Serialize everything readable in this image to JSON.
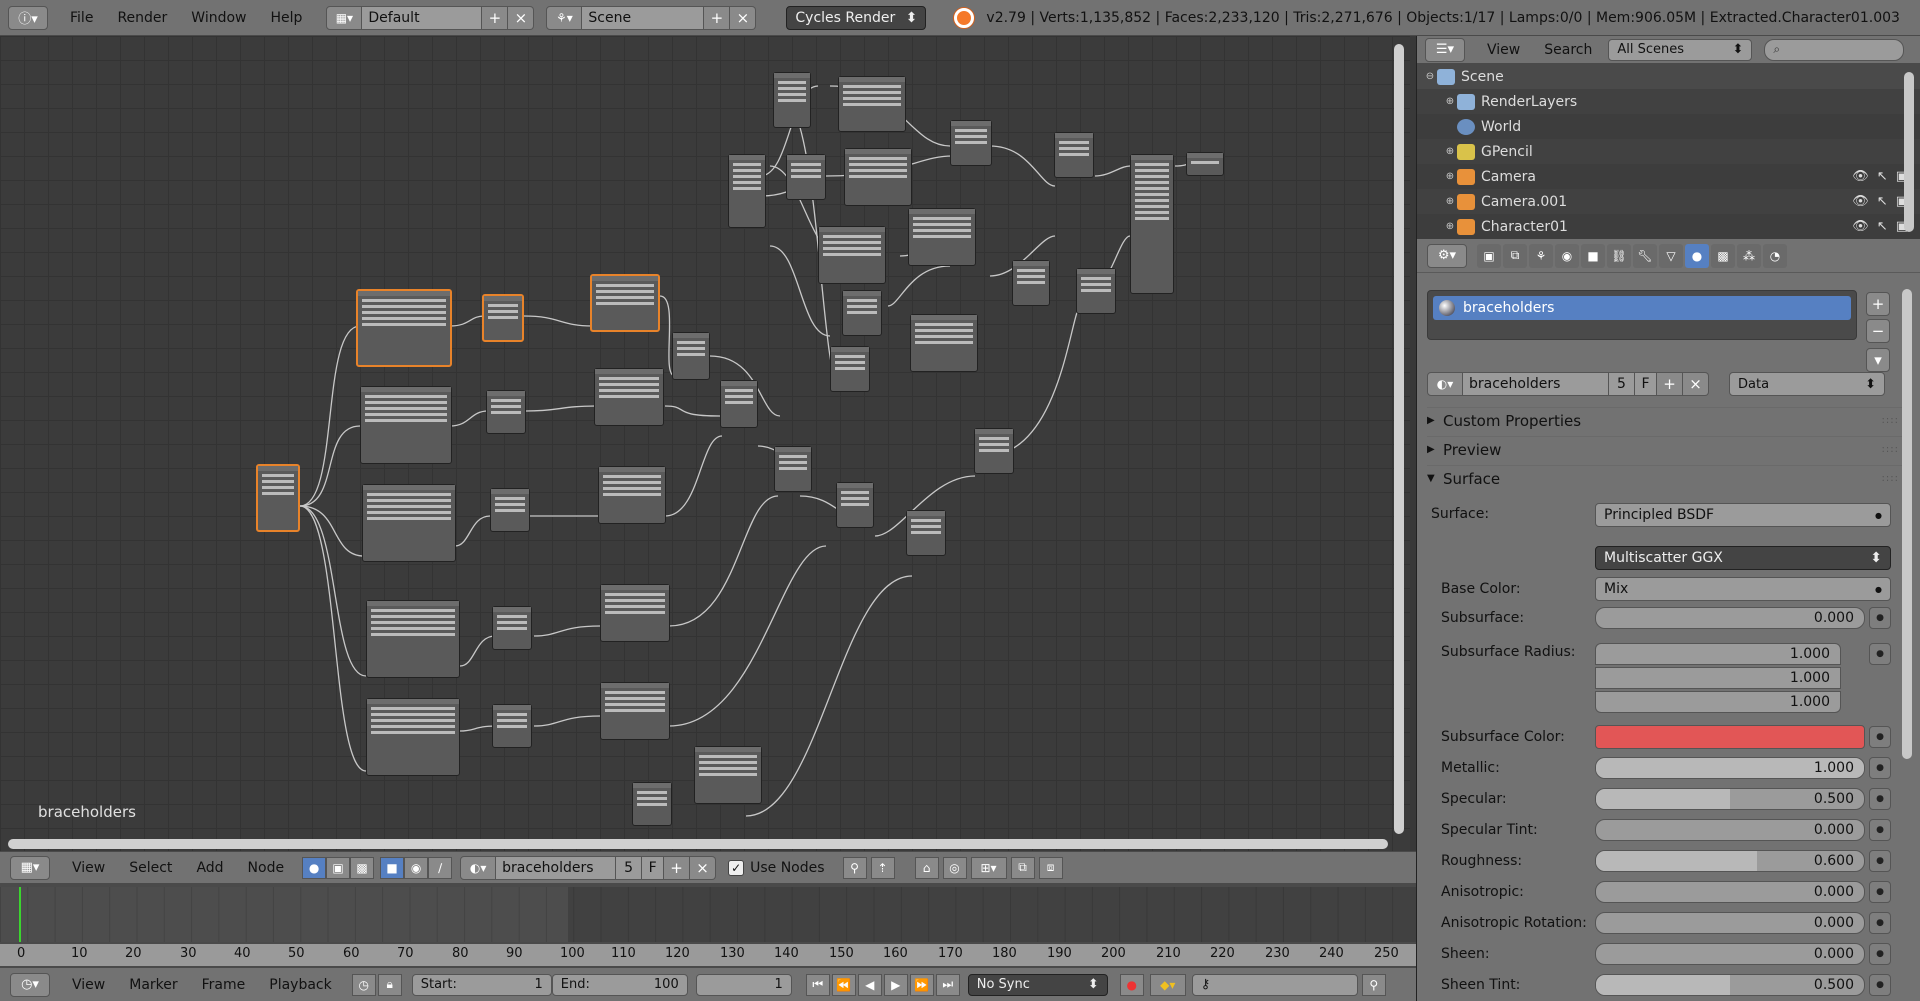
{
  "topbar": {
    "menus": [
      "File",
      "Render",
      "Window",
      "Help"
    ],
    "screen_layout": "Default",
    "scene": "Scene",
    "render_engine": "Cycles Render",
    "stats": "v2.79 | Verts:1,135,852 | Faces:2,233,120 | Tris:2,271,676 | Objects:1/17 | Lamps:0/0 | Mem:906.05M | Extracted.Character01.003"
  },
  "node_editor": {
    "material_label": "braceholders",
    "header_menus": [
      "View",
      "Select",
      "Add",
      "Node"
    ],
    "material_name": "braceholders",
    "users": "5",
    "fake_user": "F",
    "use_nodes_label": "Use Nodes"
  },
  "timeline": {
    "ticks": [
      "0",
      "10",
      "20",
      "30",
      "40",
      "50",
      "60",
      "70",
      "80",
      "90",
      "100",
      "110",
      "120",
      "130",
      "140",
      "150",
      "160",
      "170",
      "180",
      "190",
      "200",
      "210",
      "220",
      "230",
      "240",
      "250"
    ],
    "menus": [
      "View",
      "Marker",
      "Frame",
      "Playback"
    ],
    "start_label": "Start:",
    "start_value": "1",
    "end_label": "End:",
    "end_value": "100",
    "current_frame": "1",
    "sync": "No Sync"
  },
  "outliner": {
    "menus": [
      "View",
      "Search"
    ],
    "display_mode": "All Scenes",
    "rows": [
      {
        "label": "Scene",
        "color": "#8fb2d9"
      },
      {
        "label": "RenderLayers",
        "color": "#8fb2d9"
      },
      {
        "label": "World",
        "color": "#6a8fc0"
      },
      {
        "label": "GPencil",
        "color": "#d9c24a"
      },
      {
        "label": "Camera",
        "color": "#e8913a"
      },
      {
        "label": "Camera.001",
        "color": "#e8913a"
      },
      {
        "label": "Character01",
        "color": "#e8913a"
      }
    ]
  },
  "properties": {
    "slot_name": "braceholders",
    "material_name": "braceholders",
    "users": "5",
    "fake_user": "F",
    "link": "Data",
    "panels": {
      "custom_properties": "Custom Properties",
      "preview": "Preview",
      "surface": "Surface"
    },
    "surface_label": "Surface:",
    "surface_value": "Principled BSDF",
    "distribution": "Multiscatter GGX",
    "base_color_label": "Base Color:",
    "base_color_value": "Mix",
    "subsurface_color_label": "Subsurface Color:",
    "subsurface_color": "#e25656",
    "subsurface_radius_label": "Subsurface Radius:",
    "subsurface_radius": [
      "1.000",
      "1.000",
      "1.000"
    ],
    "sliders": [
      {
        "label": "Subsurface:",
        "value": "0.000",
        "fill": 0.0
      },
      {
        "label": "Metallic:",
        "value": "1.000",
        "fill": 1.0
      },
      {
        "label": "Specular:",
        "value": "0.500",
        "fill": 0.5
      },
      {
        "label": "Specular Tint:",
        "value": "0.000",
        "fill": 0.0
      },
      {
        "label": "Roughness:",
        "value": "0.600",
        "fill": 0.6
      },
      {
        "label": "Anisotropic:",
        "value": "0.000",
        "fill": 0.0
      },
      {
        "label": "Anisotropic Rotation:",
        "value": "0.000",
        "fill": 0.0
      },
      {
        "label": "Sheen:",
        "value": "0.000",
        "fill": 0.0
      },
      {
        "label": "Sheen Tint:",
        "value": "0.500",
        "fill": 0.5
      }
    ]
  },
  "colors": {
    "accent": "#5680c2",
    "selected_node": "#e8832a",
    "frame_cursor": "#3bd52e"
  }
}
